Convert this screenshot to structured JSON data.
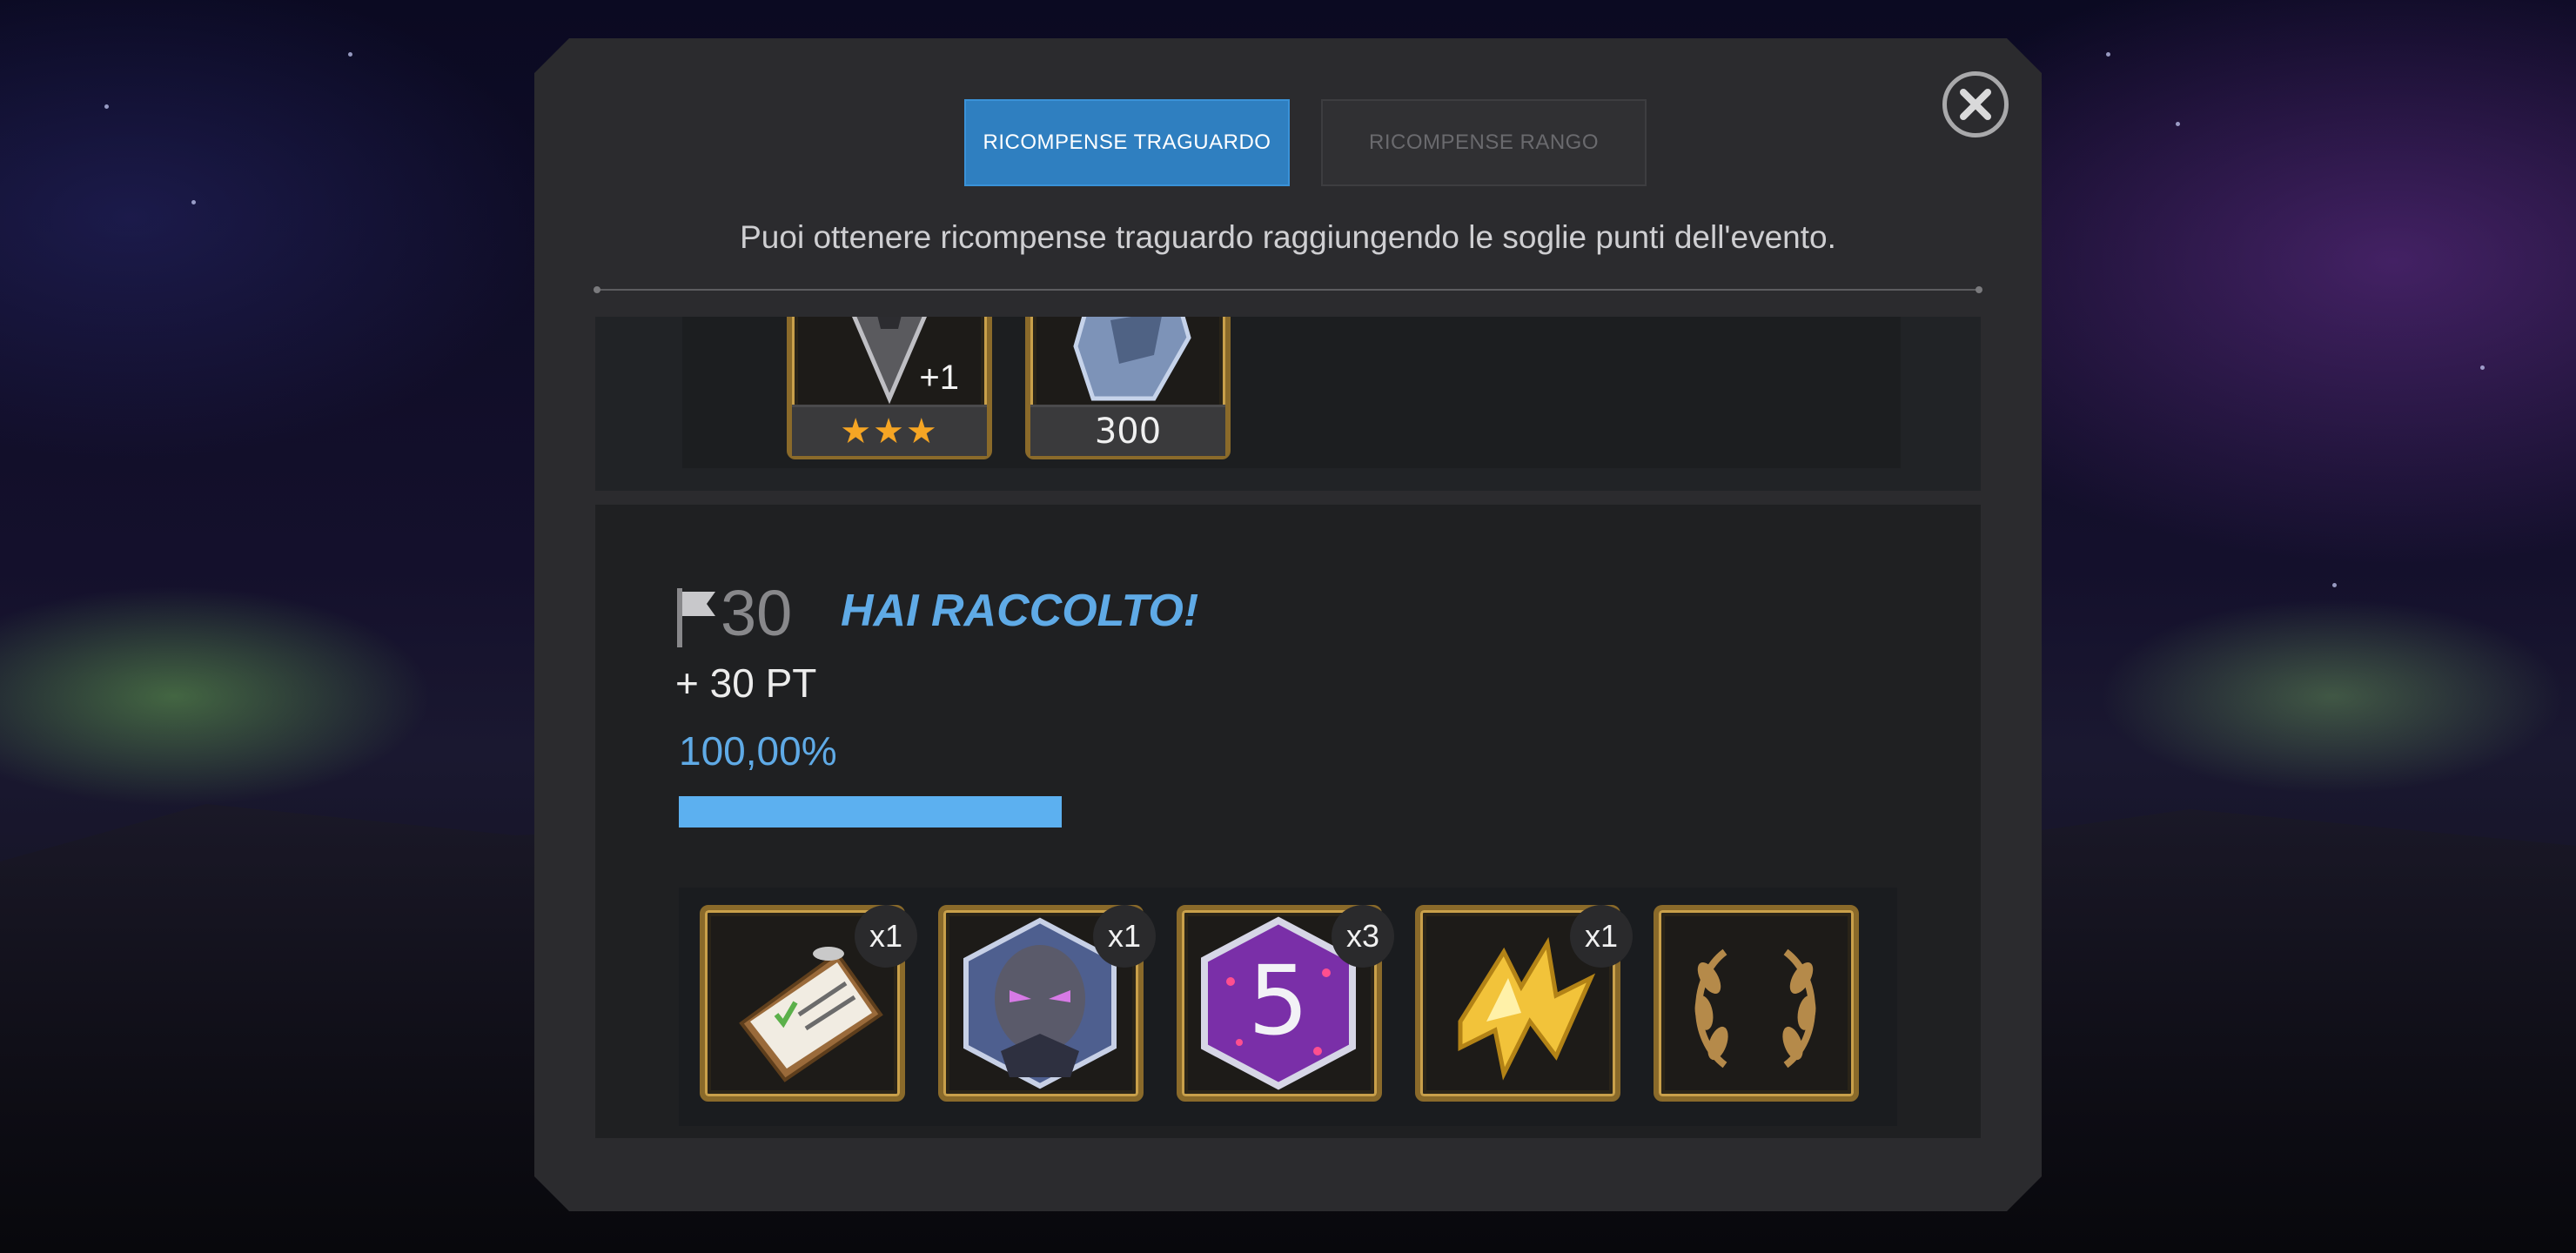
{
  "tabs": {
    "milestone_label": "RICOMPENSE TRAGUARDO",
    "rank_label": "RICOMPENSE RANGO"
  },
  "description": "Puoi ottenere ricompense traguardo raggiungendo le soglie punti dell'evento.",
  "previous_milestone": {
    "rewards": [
      {
        "icon": "crystal-shard-icon",
        "overlay": "+1",
        "stars": "★★★"
      },
      {
        "icon": "iso-armor-icon",
        "amount": "300"
      }
    ]
  },
  "milestone": {
    "number": "30",
    "status": "HAI RACCOLTO!",
    "points": "+ 30 PT",
    "progress_text": "100,00%",
    "progress_fraction": 1.0,
    "rewards": [
      {
        "icon": "clipboard-checklist-icon",
        "count": "x1"
      },
      {
        "icon": "hero-portrait-icon",
        "count": "x1"
      },
      {
        "icon": "level-5-hexagon-icon",
        "count": "x3",
        "glyph": "5"
      },
      {
        "icon": "gold-energy-bolt-icon",
        "count": "x1"
      },
      {
        "icon": "laurel-wreath-icon",
        "count": ""
      }
    ]
  },
  "colors": {
    "accent_blue": "#2f7fc0",
    "highlight_blue": "#5faae6",
    "gold_frame": "#c9a04a"
  }
}
